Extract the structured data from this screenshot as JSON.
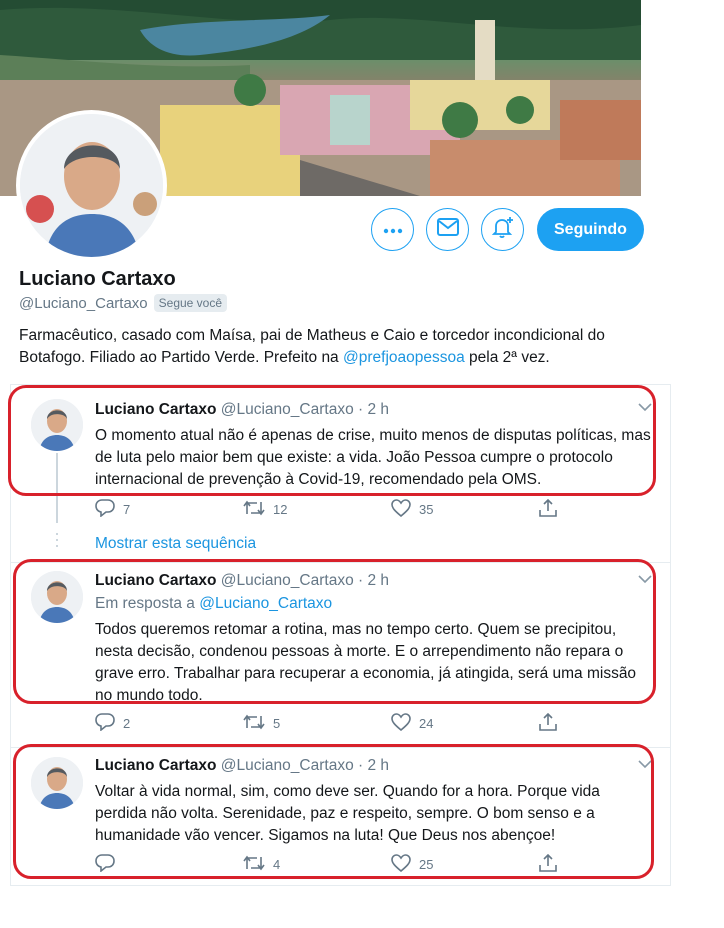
{
  "profile": {
    "name": "Luciano Cartaxo",
    "handle": "@Luciano_Cartaxo",
    "follows_you": "Segue você",
    "bio_text": "Farmacêutico, casado com Maísa, pai de Matheus e Caio e torcedor incondicional do Botafogo. Filiado ao Partido Verde. Prefeito na ",
    "bio_link": "@prefjoaopessoa",
    "bio_suffix": " pela 2ª vez.",
    "follow_button": "Seguindo"
  },
  "icons": {
    "more": "more-options-icon",
    "message": "mail-icon",
    "notify": "bell-plus-icon",
    "reply": "reply-icon",
    "retweet": "retweet-icon",
    "like": "heart-icon",
    "share": "share-icon",
    "caret": "chevron-down-icon"
  },
  "colors": {
    "accent": "#1da1f2",
    "link": "#1b95e0",
    "highlight": "#d8212b",
    "muted": "#657786"
  },
  "show_thread": "Mostrar esta sequência",
  "tweets": [
    {
      "name": "Luciano Cartaxo",
      "handle": "@Luciano_Cartaxo",
      "time": "· 2 h",
      "reply_to_label": "",
      "reply_to_handle": "",
      "text": "O momento atual não é apenas de crise, muito menos de disputas políticas, mas de luta pelo maior bem que existe: a vida. João Pessoa cumpre o protocolo internacional de prevenção à Covid-19, recomendado pela OMS.",
      "replies": "7",
      "retweets": "12",
      "likes": "35"
    },
    {
      "name": "Luciano Cartaxo",
      "handle": "@Luciano_Cartaxo",
      "time": "· 2 h",
      "reply_to_label": "Em resposta a ",
      "reply_to_handle": "@Luciano_Cartaxo",
      "text": "Todos queremos retomar a rotina, mas no tempo certo. Quem se precipitou, nesta decisão, condenou pessoas à morte. E o arrependimento não repara o grave erro. Trabalhar para recuperar a economia, já atingida, será uma missão no mundo todo.",
      "replies": "2",
      "retweets": "5",
      "likes": "24"
    },
    {
      "name": "Luciano Cartaxo",
      "handle": "@Luciano_Cartaxo",
      "time": "· 2 h",
      "reply_to_label": "",
      "reply_to_handle": "",
      "text": "Voltar à vida normal, sim, como deve ser. Quando for a hora. Porque vida perdida não volta. Serenidade, paz e respeito, sempre. O bom senso e a humanidade vão vencer. Sigamos na luta! Que Deus nos abençoe!",
      "replies": "",
      "retweets": "4",
      "likes": "25"
    }
  ]
}
